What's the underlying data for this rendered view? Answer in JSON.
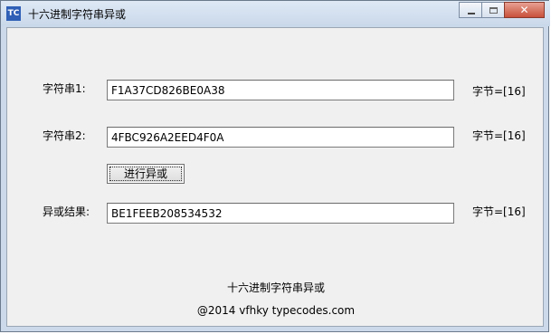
{
  "window": {
    "icon_text": "TC",
    "title": "十六进制字符串异或",
    "close_glyph": "✕"
  },
  "form": {
    "string1_label": "字符串1:",
    "string1_value": "F1A37CD826BE0A38",
    "string1_bytes": "字节=[16]",
    "string2_label": "字符串2:",
    "string2_value": "4FBC926A2EED4F0A",
    "string2_bytes": "字节=[16]",
    "xor_button": "进行异或",
    "result_label": "异或结果:",
    "result_value": "BE1FEEB208534532",
    "result_bytes": "字节=[16]"
  },
  "footer": {
    "title": "十六进制字符串异或",
    "copyright": "@2014 vfhky typecodes.com"
  }
}
